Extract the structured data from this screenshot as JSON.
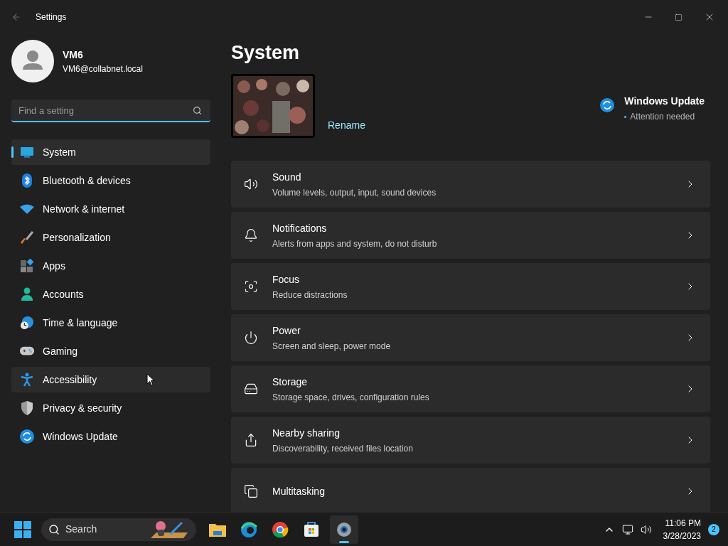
{
  "window": {
    "title": "Settings"
  },
  "account": {
    "name": "VM6",
    "email": "VM6@collabnet.local"
  },
  "search": {
    "placeholder": "Find a setting"
  },
  "sidebar": {
    "items": [
      {
        "label": "System",
        "selected": true,
        "hovered": false
      },
      {
        "label": "Bluetooth & devices",
        "selected": false,
        "hovered": false
      },
      {
        "label": "Network & internet",
        "selected": false,
        "hovered": false
      },
      {
        "label": "Personalization",
        "selected": false,
        "hovered": false
      },
      {
        "label": "Apps",
        "selected": false,
        "hovered": false
      },
      {
        "label": "Accounts",
        "selected": false,
        "hovered": false
      },
      {
        "label": "Time & language",
        "selected": false,
        "hovered": false
      },
      {
        "label": "Gaming",
        "selected": false,
        "hovered": false
      },
      {
        "label": "Accessibility",
        "selected": false,
        "hovered": true
      },
      {
        "label": "Privacy & security",
        "selected": false,
        "hovered": false
      },
      {
        "label": "Windows Update",
        "selected": false,
        "hovered": false
      }
    ]
  },
  "page": {
    "title": "System",
    "rename": "Rename",
    "update": {
      "title": "Windows Update",
      "status": "Attention needed"
    }
  },
  "settings": [
    {
      "title": "Sound",
      "subtitle": "Volume levels, output, input, sound devices"
    },
    {
      "title": "Notifications",
      "subtitle": "Alerts from apps and system, do not disturb"
    },
    {
      "title": "Focus",
      "subtitle": "Reduce distractions"
    },
    {
      "title": "Power",
      "subtitle": "Screen and sleep, power mode"
    },
    {
      "title": "Storage",
      "subtitle": "Storage space, drives, configuration rules"
    },
    {
      "title": "Nearby sharing",
      "subtitle": "Discoverability, received files location"
    },
    {
      "title": "Multitasking"
    }
  ],
  "taskbar": {
    "search": "Search",
    "time": "11:06 PM",
    "date": "3/28/2023",
    "notifications": "2"
  }
}
